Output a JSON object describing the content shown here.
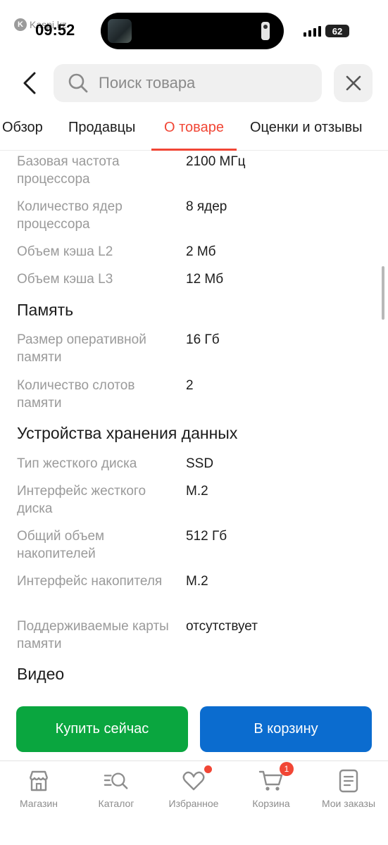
{
  "status": {
    "carrier": "Kaspi.kz",
    "time": "09:52",
    "battery": "62"
  },
  "header": {
    "search_placeholder": "Поиск товара"
  },
  "tabs": [
    {
      "label": "Обзор"
    },
    {
      "label": "Продавцы"
    },
    {
      "label": "О товаре",
      "active": true
    },
    {
      "label": "Оценки и отзывы"
    }
  ],
  "specs": {
    "cpu_freq": {
      "label": "Базовая частота процессора",
      "value": "2100 МГц"
    },
    "cpu_cores": {
      "label": "Количество ядер процессора",
      "value": "8 ядер"
    },
    "cache_l2": {
      "label": "Объем кэша L2",
      "value": "2 Мб"
    },
    "cache_l3": {
      "label": "Объем кэша L3",
      "value": "12 Мб"
    },
    "memory_title": "Память",
    "ram_size": {
      "label": "Размер оперативной памяти",
      "value": "16 Гб"
    },
    "ram_slots": {
      "label": "Количество слотов памяти",
      "value": "2"
    },
    "storage_title": "Устройства хранения данных",
    "disk_type": {
      "label": "Тип жесткого диска",
      "value": "SSD"
    },
    "disk_interface": {
      "label": "Интерфейс жесткого диска",
      "value": "M.2"
    },
    "total_storage": {
      "label": "Общий объем накопителей",
      "value": "512 Гб"
    },
    "drive_interface": {
      "label": "Интерфейс накопителя",
      "value": "M.2"
    },
    "memory_cards": {
      "label": "Поддерживаемые карты памяти",
      "value": "отсутствует"
    },
    "video_title": "Видео"
  },
  "actions": {
    "buy_now": "Купить сейчас",
    "add_to_cart": "В корзину"
  },
  "bottom_nav": {
    "shop": "Магазин",
    "catalog": "Каталог",
    "favorites": "Избранное",
    "cart": "Корзина",
    "cart_count": "1",
    "orders": "Мои заказы"
  },
  "colors": {
    "accent_red": "#f14635",
    "buy_green": "#0aa63f",
    "cart_blue": "#0b6ccf"
  }
}
